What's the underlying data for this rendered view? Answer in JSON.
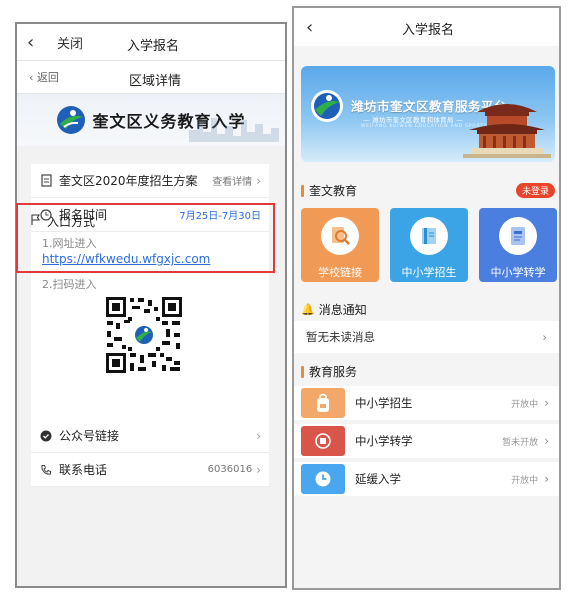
{
  "left": {
    "nav": {
      "back_icon": "chevron-left-icon",
      "close": "关闭",
      "title": "入学报名"
    },
    "subnav": {
      "back": "‹ 返回",
      "title": "区域详情"
    },
    "hero": {
      "title": "奎文区义务教育入学"
    },
    "plan": {
      "label": "奎文区2020年度招生方案",
      "action": "查看详情",
      "icon": "document-icon"
    },
    "time": {
      "label": "报名时间",
      "value": "7月25日-7月30日",
      "icon": "clock-icon"
    },
    "entry": {
      "label": "入口方式",
      "icon": "flag-icon",
      "method1": "1.网址进入",
      "url": "https://wfkwedu.wfgxjc.com",
      "method2": "2.扫码进入"
    },
    "wechat": {
      "label": "公众号链接",
      "icon": "wechat-icon"
    },
    "phone": {
      "label": "联系电话",
      "value": "6036016",
      "icon": "phone-icon"
    },
    "colors": {
      "highlight_border": "#e23a3a",
      "link": "#2b6de0"
    }
  },
  "right": {
    "nav": {
      "title": "入学报名"
    },
    "banner": {
      "title": "潍坊市奎文区教育服务平台",
      "subtitle": "— 潍坊市奎文区教育和体育局 —",
      "subtitle_en": "WEIFANG KUIWEN EDUCATION AND SPORTS BUREAU"
    },
    "section1": {
      "title": "奎文教育",
      "badge": "未登录"
    },
    "tiles": [
      {
        "label": "学校链接",
        "color": "#f09a55",
        "icon": "search-school-icon"
      },
      {
        "label": "中小学招生",
        "color": "#3aa4e6",
        "icon": "book-icon"
      },
      {
        "label": "中小学转学",
        "color": "#4a7fe0",
        "icon": "transfer-doc-icon"
      }
    ],
    "notice": {
      "title": "消息通知",
      "message": "暂无未读消息"
    },
    "section2": {
      "title": "教育服务"
    },
    "services": [
      {
        "label": "中小学招生",
        "status": "开放中",
        "color": "#f3a86a",
        "icon": "backpack-icon"
      },
      {
        "label": "中小学转学",
        "status": "暂未开放",
        "color": "#d9554a",
        "icon": "transfer-icon"
      },
      {
        "label": "延缓入学",
        "status": "开放中",
        "color": "#4aa6ee",
        "icon": "clock-icon"
      }
    ]
  }
}
